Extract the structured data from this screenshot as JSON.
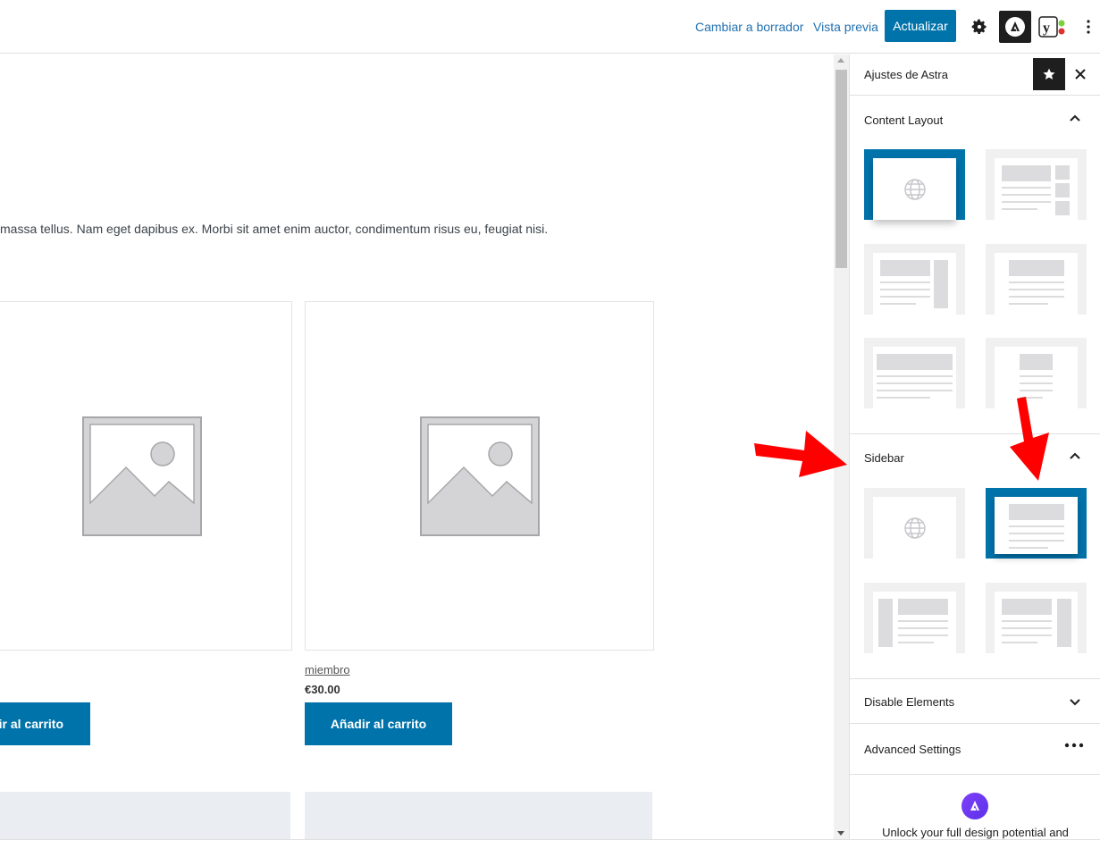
{
  "topbar": {
    "switch_draft": "Cambiar a borrador",
    "preview": "Vista previa",
    "update": "Actualizar",
    "icons": [
      "gear-icon",
      "astra-icon",
      "yoast-icon",
      "more-vertical-icon"
    ]
  },
  "content": {
    "paragraph": "massa tellus. Nam eget dapibus ex. Morbi sit amet enim auctor, condimentum risus eu, feugiat nisi.",
    "products": [
      {
        "name": "",
        "price": "",
        "button": "ir al carrito"
      },
      {
        "name": "miembro",
        "price": "€30.00",
        "button": "Añadir al carrito"
      }
    ]
  },
  "sidebar": {
    "title": "Ajustes de Astra",
    "content_layout": {
      "title": "Content Layout",
      "selected_index": 0
    },
    "sidebar_section": {
      "title": "Sidebar",
      "selected_index": 1
    },
    "disable_elements": "Disable Elements",
    "advanced_settings": "Advanced Settings",
    "promo_text": "Unlock your full design potential and"
  },
  "colors": {
    "accent": "#0073aa",
    "link": "#2271b1",
    "annotation_arrow": "#ff0000"
  }
}
